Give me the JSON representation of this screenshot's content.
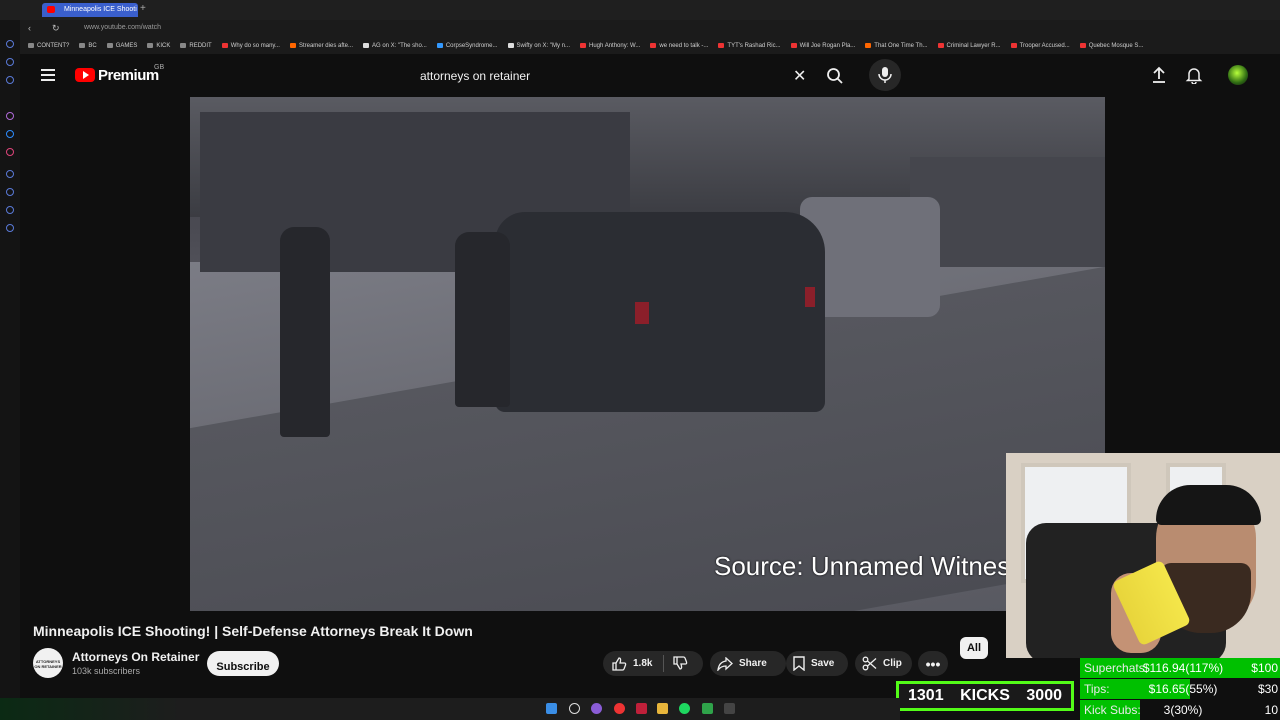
{
  "browser": {
    "tab_title": "Minneapolis ICE Shooti",
    "new_tab": "+",
    "url": "www.youtube.com/watch",
    "bookmarks": [
      "CONTENT?",
      "BC",
      "GAMES",
      "KICK",
      "REDDIT",
      "Why do so many...",
      "Streamer dies afte...",
      "AG on X: \"The sho...",
      "CorpseSyndrome...",
      "Swifty on X: \"My n...",
      "Hugh Anthony: W...",
      "we need to talk -...",
      "TYT's Rashad Ric...",
      "Will Joe Rogan Pla...",
      "That One Time Th...",
      "Criminal Lawyer R...",
      "Trooper Accused...",
      "Quebec Mosque S..."
    ]
  },
  "youtube": {
    "brand": "Premium",
    "region": "GB",
    "search_query": "attorneys on retainer",
    "video_caption": "Source: Unnamed Witnes",
    "video_title": "Minneapolis ICE Shooting! | Self-Defense Attorneys Break It Down",
    "channel": {
      "avatar_text": "ATTORNEYS ON RETAINER",
      "name": "Attorneys On Retainer",
      "subscribers": "103k subscribers",
      "subscribe_label": "Subscribe"
    },
    "actions": {
      "likes": "1.8k",
      "share": "Share",
      "save": "Save",
      "clip": "Clip",
      "more": "•••"
    },
    "chip_all": "All"
  },
  "overlay": {
    "kicks": {
      "current": "1301",
      "label": "KICKS",
      "goal": "3000"
    },
    "goals": [
      {
        "label": "Superchats",
        "value": "$116.94(117%)",
        "target": "$100",
        "fill": 1.0
      },
      {
        "label": "Tips:",
        "value": "$16.65(55%)",
        "target": "$30",
        "fill": 0.55
      },
      {
        "label": "Kick Subs:",
        "value": "3(30%)",
        "target": "10",
        "fill": 0.3
      }
    ]
  },
  "colors": {
    "accent": "#ff0000",
    "kick_green": "#53fc18",
    "goal_fill": "#00c000"
  }
}
